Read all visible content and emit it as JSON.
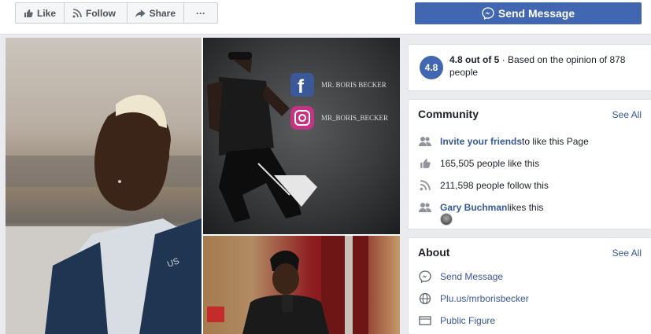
{
  "toolbar": {
    "like_label": "Like",
    "follow_label": "Follow",
    "share_label": "Share",
    "more_label": "···",
    "send_message_label": "Send Message"
  },
  "photos": {
    "instagram_overlay": {
      "facebook_handle": "MR. BORIS BECKER",
      "instagram_handle": "MR_BORIS_BECKER"
    },
    "jacket_text": "US"
  },
  "rating": {
    "badge": "4.8",
    "score": "4.8 out of 5",
    "separator": " · ",
    "description": "Based on the opinion of 878 people"
  },
  "community": {
    "title": "Community",
    "see_all": "See All",
    "invite_link": "Invite your friends",
    "invite_suffix": " to like this Page",
    "likes": "165,505 people like this",
    "follows": "211,598 people follow this",
    "friend_name": "Gary Buchman",
    "friend_suffix": " likes this"
  },
  "about": {
    "title": "About",
    "see_all": "See All",
    "send_message": "Send Message",
    "website": "Plu.us/mrborisbecker",
    "category": "Public Figure"
  },
  "colors": {
    "brand_blue": "#4267b2",
    "link_blue": "#385898",
    "page_bg": "#e9ebee"
  }
}
